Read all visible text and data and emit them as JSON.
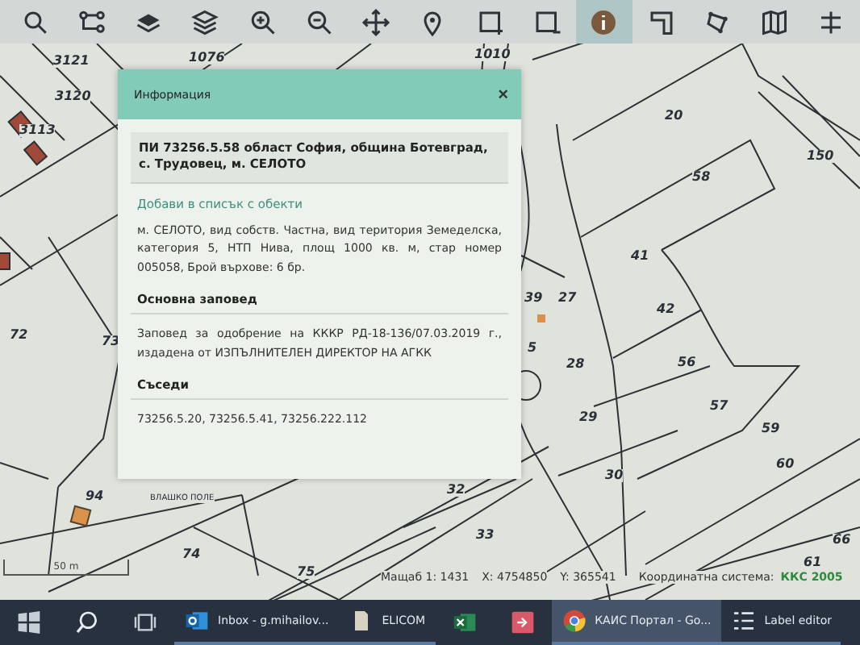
{
  "toolbar": {
    "tools": [
      {
        "kind": "search",
        "selected": false
      },
      {
        "kind": "route",
        "selected": false
      },
      {
        "kind": "layer",
        "selected": false
      },
      {
        "kind": "layers",
        "selected": false
      },
      {
        "kind": "zoom-in",
        "selected": false
      },
      {
        "kind": "zoom-out",
        "selected": false
      },
      {
        "kind": "pan",
        "selected": false
      },
      {
        "kind": "pin",
        "selected": false
      },
      {
        "kind": "select-box",
        "selected": false
      },
      {
        "kind": "deselect-box",
        "selected": false
      },
      {
        "kind": "info",
        "selected": true
      },
      {
        "kind": "measure",
        "selected": false
      },
      {
        "kind": "polygon",
        "selected": false
      },
      {
        "kind": "map",
        "selected": false
      },
      {
        "kind": "split",
        "selected": false
      }
    ]
  },
  "map": {
    "labels": [
      "3121",
      "1076",
      "1010",
      "3120",
      "3113",
      "72",
      "73",
      "94",
      "ВЛАШКО ПОЛЕ",
      "20",
      "58",
      "150",
      "41",
      "42",
      "39",
      "27",
      "5",
      "28",
      "56",
      "57",
      "29",
      "59",
      "60",
      "30",
      "32",
      "33",
      "74",
      "75",
      "61",
      "66"
    ],
    "scale_bar": "50 m"
  },
  "dialog": {
    "title": "Информация",
    "close": "×",
    "heading": "ПИ 73256.5.58 област София, община Ботевград, с. Трудовец, м. СЕЛОТО",
    "link": "Добави в списък с обекти",
    "description": "м. СЕЛОТО, вид собств. Частна, вид територия Земеделска, категория 5, НТП Нива, площ 1000 кв. м, стар номер 005058, Брой върхове: 6 бр.",
    "sections": [
      {
        "title": "Основна заповед",
        "text": "Заповед за одобрение на КККР РД-18-136/07.03.2019 г., издадена от ИЗПЪЛНИТЕЛЕН ДИРЕКТОР НА АГКК"
      },
      {
        "title": "Съседи",
        "text": "73256.5.20, 73256.5.41, 73256.222.112"
      }
    ]
  },
  "status_bar": {
    "scale": "Мащаб 1:  1431",
    "x": "X:  4754850",
    "y": "Y:  365541",
    "crs_label": "Координатна система:",
    "crs": "ККС 2005"
  },
  "taskbar": {
    "items": [
      {
        "kind": "start",
        "selected": false
      },
      {
        "kind": "search",
        "selected": false
      },
      {
        "kind": "taskview",
        "selected": false
      },
      {
        "kind": "outlook",
        "label": "Inbox - g.mihailov...",
        "selected": false
      },
      {
        "kind": "file",
        "label": "ELICOM",
        "selected": false
      },
      {
        "kind": "excel",
        "selected": false
      },
      {
        "kind": "remote",
        "selected": false
      },
      {
        "kind": "chrome",
        "label": "КАИС Портал - Go...",
        "selected": true
      },
      {
        "kind": "list",
        "label": "Label editor",
        "selected": false
      }
    ]
  }
}
